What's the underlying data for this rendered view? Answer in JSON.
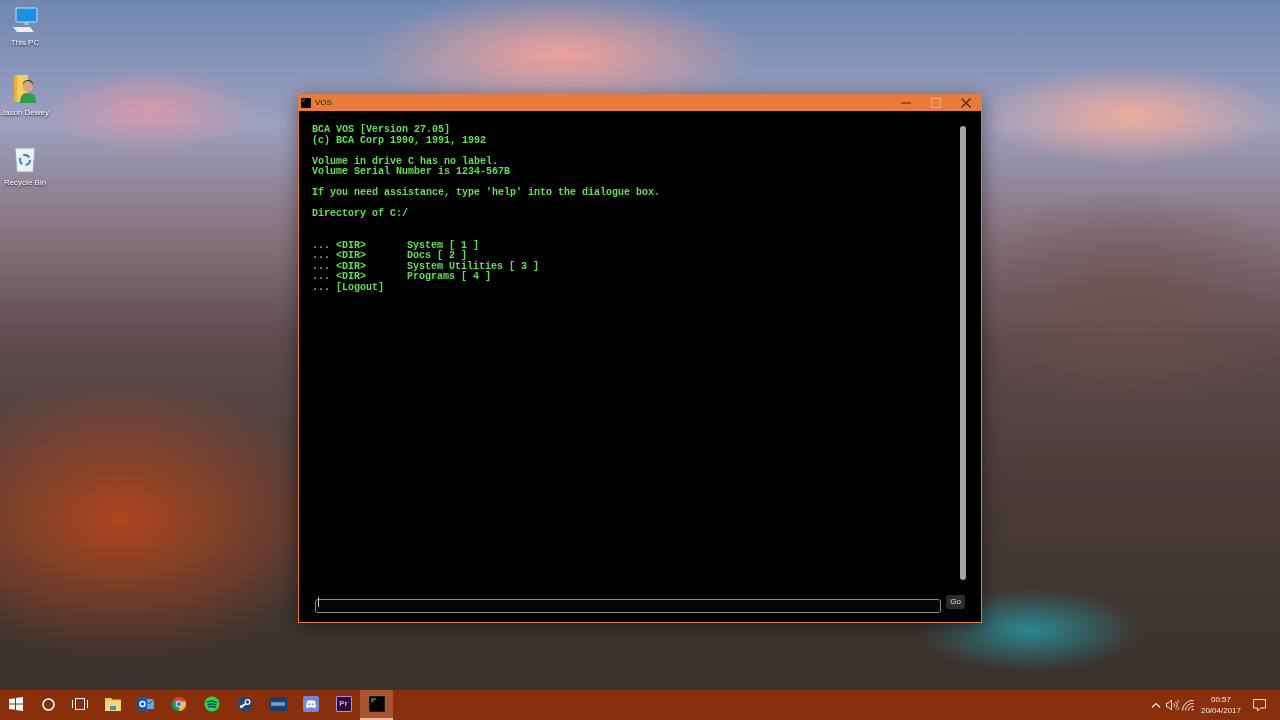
{
  "desktop_icons": [
    {
      "kind": "computer",
      "label": "This PC"
    },
    {
      "kind": "user-folder",
      "label": "Jason Dewey"
    },
    {
      "kind": "recycle-bin",
      "label": "Recycle Bin"
    }
  ],
  "window": {
    "title": "VOS",
    "controls": [
      {
        "kind": "minimize",
        "disabled": false
      },
      {
        "kind": "maximize",
        "disabled": true
      },
      {
        "kind": "close",
        "disabled": false
      }
    ],
    "terminal": {
      "paragraphs": [
        [
          "BCA VOS [Version 27.05]",
          "(c) BCA Corp 1990, 1991, 1992"
        ],
        [
          "Volume in drive C has no label.",
          "Volume Serial Number is 1234-567B"
        ],
        [
          "If you need assistance, type 'help' into the dialogue box."
        ],
        [
          "Directory of C:/"
        ]
      ],
      "listing": [
        {
          "kind": "dir",
          "prefix": "... <DIR>",
          "name": "System [ 1 ]"
        },
        {
          "kind": "dir",
          "prefix": "... <DIR>",
          "name": "Docs [ 2 ]"
        },
        {
          "kind": "dir",
          "prefix": "... <DIR>",
          "name": "System Utilities [ 3 ]"
        },
        {
          "kind": "dir",
          "prefix": "... <DIR>",
          "name": "Programs [ 4 ]"
        },
        {
          "kind": "command",
          "prefix": "...",
          "name": "[Logout]"
        }
      ]
    },
    "command_bar": {
      "button": "Go"
    }
  },
  "taskbar": {
    "items": [
      {
        "kind": "start",
        "selected": false
      },
      {
        "kind": "search",
        "selected": false
      },
      {
        "kind": "task-view",
        "selected": false
      },
      {
        "kind": "folder",
        "selected": false
      },
      {
        "kind": "mail",
        "selected": false
      },
      {
        "kind": "browser",
        "selected": false
      },
      {
        "kind": "music",
        "selected": false
      },
      {
        "kind": "game-store",
        "selected": false
      },
      {
        "kind": "screen-app",
        "selected": false
      },
      {
        "kind": "chat",
        "selected": false
      },
      {
        "kind": "video-editor",
        "label": "Pr",
        "selected": false
      },
      {
        "kind": "terminal",
        "selected": true
      }
    ],
    "tray": {
      "time": "00:57",
      "date": "20/04/2017"
    }
  }
}
